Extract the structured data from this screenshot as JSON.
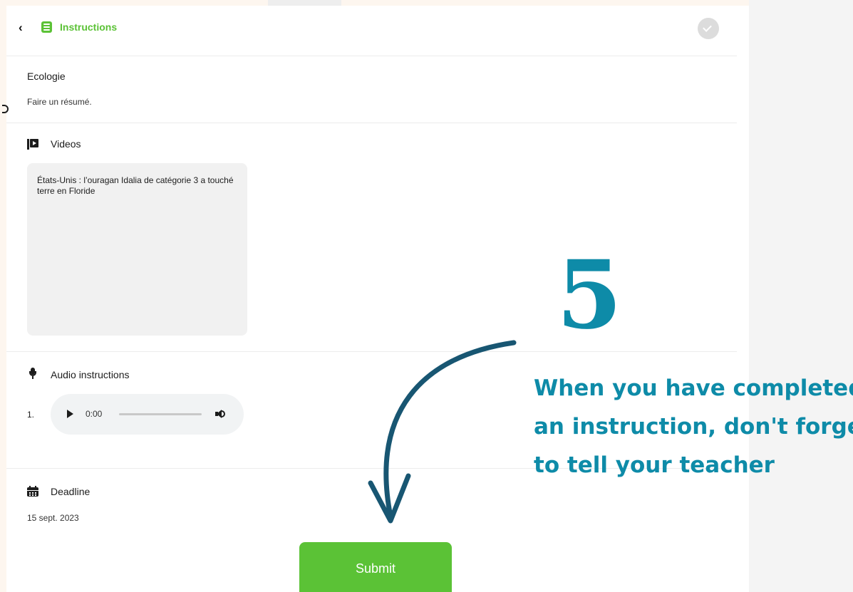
{
  "header": {
    "back_glyph": "‹",
    "title": "Instructions",
    "icons": [
      "chevron-left-icon",
      "list-icon",
      "check-icon"
    ]
  },
  "assignment": {
    "name": "Ecologie",
    "description": "Faire un résumé."
  },
  "videos": {
    "heading": "Videos",
    "items": [
      {
        "title": "États-Unis : l’ouragan Idalia de catégorie 3 a touché terre en Floride"
      }
    ]
  },
  "audio": {
    "heading": "Audio instructions",
    "items": [
      {
        "number": "1.",
        "time": "0:00",
        "progress": 0
      }
    ]
  },
  "deadline": {
    "heading": "Deadline",
    "date": "15 sept. 2023"
  },
  "submit": {
    "label": "Submit"
  },
  "overlay": {
    "step_number": "5",
    "lines": [
      "When you have completed",
      "an instruction, don't forget",
      "to tell your teacher"
    ]
  },
  "colors": {
    "accent_green": "#5bc236",
    "overlay_teal": "#0e8ba8",
    "arrow_navy": "#185672"
  }
}
